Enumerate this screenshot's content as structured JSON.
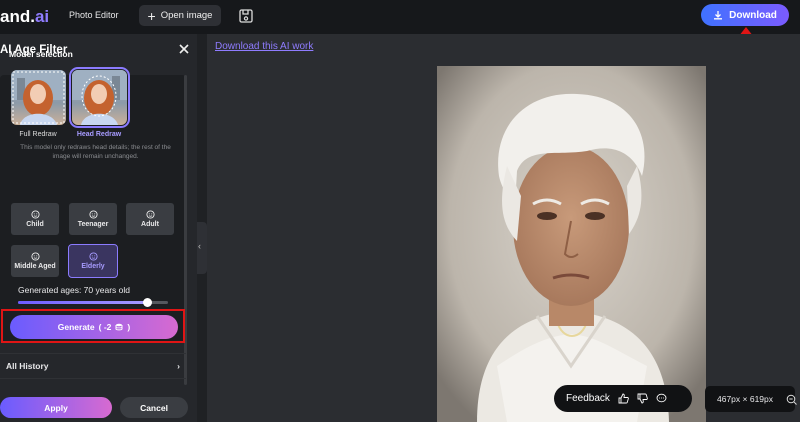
{
  "topbar": {
    "logo_main": "and.",
    "logo_ai": "ai",
    "photo_editor": "Photo Editor",
    "open_image": "Open image",
    "download": "Download"
  },
  "panel": {
    "title": "AI Age Filter",
    "model_selection": "Model selection",
    "models": [
      {
        "label": "Full Redraw",
        "selected": false
      },
      {
        "label": "Head Redraw",
        "selected": true
      }
    ],
    "description": "This model only redraws head details; the rest of the image will remain unchanged.",
    "ages": [
      {
        "label": "Child",
        "selected": false
      },
      {
        "label": "Teenager",
        "selected": false
      },
      {
        "label": "Adult",
        "selected": false
      },
      {
        "label": "Middle Aged",
        "selected": false
      },
      {
        "label": "Elderly",
        "selected": true
      }
    ],
    "generated_ages": "Generated ages: 70 years old",
    "age_slider_fraction": 0.86,
    "generate_label": "Generate",
    "generate_cost": "( -2",
    "generate_cost_close": ")",
    "all_history": "All History",
    "apply": "Apply",
    "cancel": "Cancel"
  },
  "canvas": {
    "download_link": "Download this AI work",
    "feedback": "Feedback",
    "dimensions": "467px × 619px"
  },
  "colors": {
    "accent": "#8f7cff",
    "highlight_red": "#e01515",
    "download_gradient_start": "#3f72ff"
  }
}
